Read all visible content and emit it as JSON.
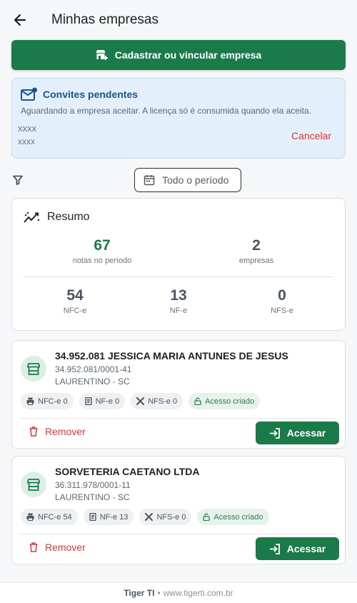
{
  "header": {
    "title": "Minhas empresas"
  },
  "actions": {
    "register_label": "Cadastrar ou vincular empresa"
  },
  "invite": {
    "title": "Convites pendentes",
    "description": "Aguardando a empresa aceitar. A licença só é consumida quando ela aceita.",
    "line1": "xxxx",
    "line2": "xxxx",
    "cancel_label": "Cancelar"
  },
  "filter": {
    "period_label": "Todo o período"
  },
  "summary": {
    "title": "Resumo",
    "notes_count": "67",
    "notes_label": "notas no período",
    "companies_count": "2",
    "companies_label": "empresas",
    "nfce_count": "54",
    "nfce_label": "NFC-e",
    "nfe_count": "13",
    "nfe_label": "NF-e",
    "nfse_count": "0",
    "nfse_label": "NFS-e"
  },
  "companies": [
    {
      "name": "34.952.081 JESSICA MARIA ANTUNES DE JESUS",
      "cnpj": "34.952.081/0001-41",
      "city": "LAURENTINO - SC",
      "chips": {
        "nfce": "NFC-e 0",
        "nfe": "NF-e 0",
        "nfse": "NFS-e 0",
        "access": "Acesso criado"
      },
      "remove_label": "Remover",
      "access_label": "Acessar"
    },
    {
      "name": "SORVETERIA CAETANO LTDA",
      "cnpj": "36.311.978/0001-11",
      "city": "LAURENTINO - SC",
      "chips": {
        "nfce": "NFC-e 54",
        "nfe": "NF-e 13",
        "nfse": "NFS-e 0",
        "access": "Acesso criado"
      },
      "remove_label": "Remover",
      "access_label": "Acessar"
    }
  ],
  "footer": {
    "brand": "Tiger TI",
    "separator": "•",
    "url": "www.tigerti.com.br"
  },
  "colors": {
    "primary": "#1b7a4a",
    "danger": "#d33a3a",
    "info_bg": "#e3f0fb",
    "info_title": "#1d4f91"
  },
  "icons": [
    "arrow-left-icon",
    "store-add-icon",
    "mail-badge-icon",
    "filter-icon",
    "calendar-icon",
    "trend-icon",
    "store-icon",
    "printer-icon",
    "receipt-icon",
    "tools-icon",
    "lock-open-icon",
    "trash-icon",
    "login-icon"
  ]
}
